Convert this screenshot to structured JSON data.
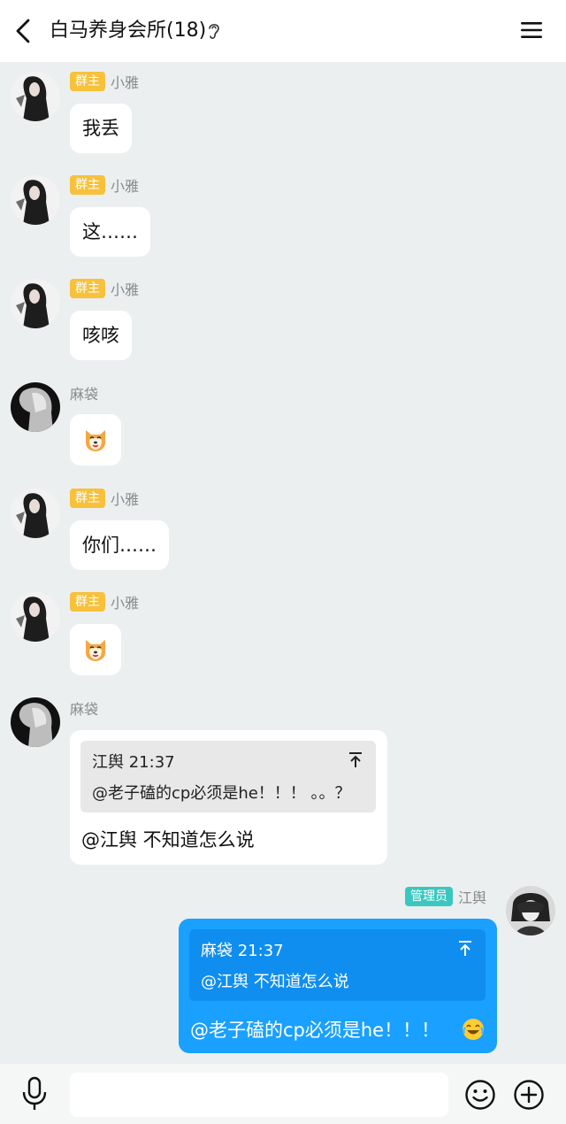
{
  "header": {
    "title": "白马养身会所(18)",
    "icons": [
      "back-arrow-icon",
      "ear-icon",
      "hamburger-menu-icon"
    ]
  },
  "messages": [
    {
      "sender": "小雅",
      "badge": "群主",
      "type": "text",
      "text": "我丢"
    },
    {
      "sender": "小雅",
      "badge": "群主",
      "type": "text",
      "text": "这……"
    },
    {
      "sender": "小雅",
      "badge": "群主",
      "type": "text",
      "text": "咳咳"
    },
    {
      "sender": "麻袋",
      "badge": "",
      "type": "sticker",
      "sticker": "shiba-face-sticker"
    },
    {
      "sender": "小雅",
      "badge": "群主",
      "type": "text",
      "text": "你们……"
    },
    {
      "sender": "小雅",
      "badge": "群主",
      "type": "sticker",
      "sticker": "shiba-face-sticker"
    },
    {
      "sender": "麻袋",
      "badge": "",
      "type": "reply",
      "quote": {
        "author_time": "江舆 21:37",
        "text": "@老子磕的cp必须是he！！！ 。。？"
      },
      "text": "@江舆 不知道怎么说"
    },
    {
      "sender": "江舆",
      "badge": "管理员",
      "type": "reply",
      "mine": true,
      "quote": {
        "author_time": "麻袋 21:37",
        "text": "@江舆 不知道怎么说"
      },
      "text": "@老子磕的cp必须是he！！！",
      "emoji": "laughing-tears-emoji"
    }
  ],
  "input_bar": {
    "placeholder": "",
    "icons": [
      "microphone-icon",
      "smiley-icon",
      "plus-circle-icon"
    ]
  },
  "colors": {
    "owner_badge": "#f7c13b",
    "admin_badge": "#39c8c0",
    "my_bubble": "#1aa0ff",
    "chat_background": "#ecefef"
  }
}
